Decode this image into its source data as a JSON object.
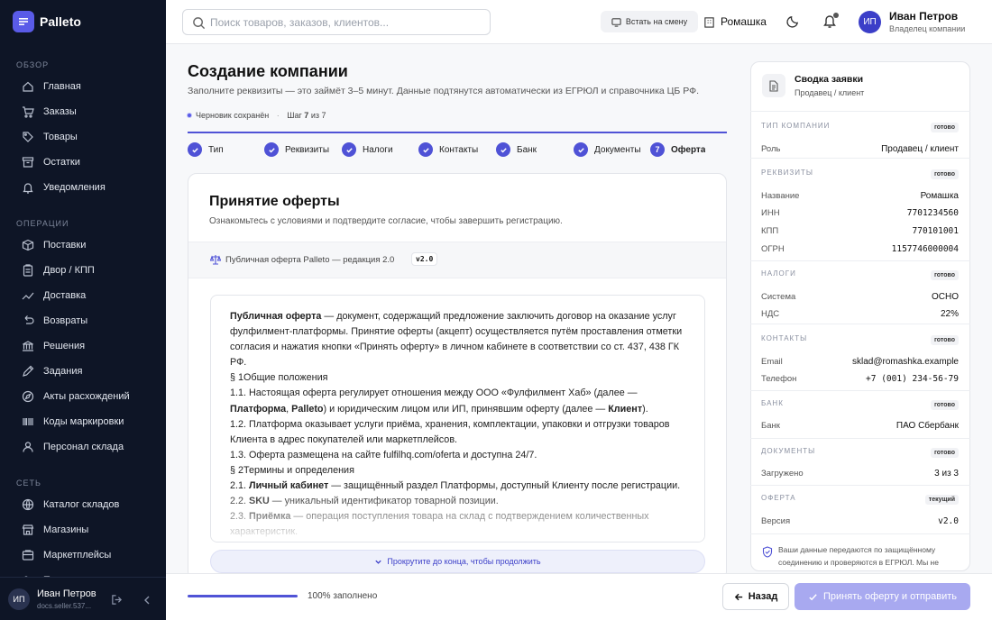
{
  "sidebar": {
    "brand": "Palleto",
    "sections": {
      "overview": "ОБЗОР",
      "operations": "ОПЕРАЦИИ",
      "network": "СЕТЬ"
    },
    "items": [
      {
        "label": "Главная",
        "icon": "home-icon"
      },
      {
        "label": "Заказы",
        "icon": "cart-icon"
      },
      {
        "label": "Товары",
        "icon": "tag-icon"
      },
      {
        "label": "Остатки",
        "icon": "archive-icon"
      },
      {
        "label": "Уведомления",
        "icon": "bell-icon"
      },
      {
        "label": "Поставки",
        "icon": "box-icon"
      },
      {
        "label": "Двор / КПП",
        "icon": "clipboard-icon"
      },
      {
        "label": "Доставка",
        "icon": "trend-icon"
      },
      {
        "label": "Возвраты",
        "icon": "return-icon"
      },
      {
        "label": "Решения",
        "icon": "bank-icon"
      },
      {
        "label": "Задания",
        "icon": "pencil-icon"
      },
      {
        "label": "Акты расхождений",
        "icon": "compass-icon"
      },
      {
        "label": "Коды маркировки",
        "icon": "barcode-icon"
      },
      {
        "label": "Персонал склада",
        "icon": "person-icon"
      },
      {
        "label": "Каталог складов",
        "icon": "globe-icon"
      },
      {
        "label": "Магазины",
        "icon": "store-icon"
      },
      {
        "label": "Маркетплейсы",
        "icon": "market-icon"
      },
      {
        "label": "Подписчики",
        "icon": "users-icon"
      }
    ],
    "user": {
      "initials": "ИП",
      "name": "Иван Петров",
      "email": "docs.seller.537..."
    }
  },
  "header": {
    "search_placeholder": "Поиск товаров, заказов, клиентов...",
    "shift_button": "Встать на смену",
    "company": "Ромашка",
    "user": {
      "initials": "ИП",
      "name": "Иван Петров",
      "role": "Владелец компании"
    }
  },
  "page": {
    "title": "Создание компании",
    "subtitle": "Заполните реквизиты — это займёт 3–5 минут. Данные подтянутся автоматически из ЕГРЮЛ и справочника ЦБ РФ.",
    "draft": "Черновик сохранён",
    "step_prefix": "Шаг",
    "step_current": "7",
    "step_of": "из",
    "step_total": "7",
    "steps": [
      "Тип",
      "Реквизиты",
      "Налоги",
      "Контакты",
      "Банк",
      "Документы",
      "Оферта"
    ],
    "current_step_number": "7"
  },
  "offer": {
    "title": "Принятие оферты",
    "subtitle": "Ознакомьтесь с условиями и подтвердите согласие, чтобы завершить регистрацию.",
    "doc_label": "Публичная оферта Palleto — редакция 2.0",
    "version": "v2.0",
    "paragraphs": [
      [
        {
          "b": "Публичная оферта"
        },
        {
          "t": " — документ, содержащий предложение заключить договор на оказание услуг фулфилмент-платформы. Принятие оферты (акцепт) осуществляется путём проставления отметки согласия и нажатия кнопки «Принять оферту» в личном кабинете в соответствии со ст. 437, 438 ГК РФ."
        }
      ],
      [
        {
          "t": "§ 1Общие положения"
        }
      ],
      [
        {
          "t": "1.1. Настоящая оферта регулирует отношения между ООО «Фулфилмент Хаб» (далее — "
        },
        {
          "b": "Платформа"
        },
        {
          "t": ", "
        },
        {
          "b": "Palleto"
        },
        {
          "t": ") и юридическим лицом или ИП, принявшим оферту (далее — "
        },
        {
          "b": "Клиент"
        },
        {
          "t": ")."
        }
      ],
      [
        {
          "t": "1.2. Платформа оказывает услуги приёма, хранения, комплектации, упаковки и отгрузки товаров Клиента в адрес покупателей или маркетплейсов."
        }
      ],
      [
        {
          "t": "1.3. Оферта размещена на сайте fulfilhq.com/oferta и доступна 24/7."
        }
      ],
      [
        {
          "t": "§ 2Термины и определения"
        }
      ],
      [
        {
          "t": "2.1. "
        },
        {
          "b": "Личный кабинет"
        },
        {
          "t": " — защищённый раздел Платформы, доступный Клиенту после регистрации."
        }
      ],
      [
        {
          "t": "2.2. "
        },
        {
          "b": "SKU"
        },
        {
          "t": " — уникальный идентификатор товарной позиции."
        }
      ],
      [
        {
          "t": "2.3. "
        },
        {
          "b": "Приёмка"
        },
        {
          "t": " — операция поступления товара на склад с подтверждением количественных характеристик."
        }
      ]
    ],
    "scroll_hint": "Прокрутите до конца, чтобы продолжить"
  },
  "footer": {
    "progress_percent": 100,
    "progress_text": "100% заполнено",
    "back": "Назад",
    "submit": "Принять оферту и отправить"
  },
  "summary": {
    "title": "Сводка заявки",
    "subtitle": "Продавец / клиент",
    "sections": [
      {
        "name": "ТИП КОМПАНИИ",
        "badge": "готово",
        "rows": [
          {
            "k": "Роль",
            "v": "Продавец / клиент",
            "mono": false
          }
        ]
      },
      {
        "name": "РЕКВИЗИТЫ",
        "badge": "готово",
        "rows": [
          {
            "k": "Название",
            "v": "Ромашка",
            "mono": false
          },
          {
            "k": "ИНН",
            "v": "7701234560",
            "mono": true
          },
          {
            "k": "КПП",
            "v": "770101001",
            "mono": true
          },
          {
            "k": "ОГРН",
            "v": "1157746000004",
            "mono": true
          }
        ]
      },
      {
        "name": "НАЛОГИ",
        "badge": "готово",
        "rows": [
          {
            "k": "Система",
            "v": "ОСНО",
            "mono": false
          },
          {
            "k": "НДС",
            "v": "22%",
            "mono": false
          }
        ]
      },
      {
        "name": "КОНТАКТЫ",
        "badge": "готово",
        "rows": [
          {
            "k": "Email",
            "v": "sklad@romashka.example",
            "mono": false
          },
          {
            "k": "Телефон",
            "v": "+7 (001) 234-56-79",
            "mono": true
          }
        ]
      },
      {
        "name": "БАНК",
        "badge": "готово",
        "rows": [
          {
            "k": "Банк",
            "v": "ПАО Сбербанк",
            "mono": false
          }
        ]
      },
      {
        "name": "ДОКУМЕНТЫ",
        "badge": "готово",
        "rows": [
          {
            "k": "Загружено",
            "v": "3 из 3",
            "mono": false
          }
        ]
      },
      {
        "name": "ОФЕРТА",
        "badge": "текущий",
        "rows": [
          {
            "k": "Версия",
            "v": "v2.0",
            "mono": true
          }
        ]
      }
    ],
    "secure_text": "Ваши данные передаются по защищённому соединению и проверяются в ЕГРЮЛ. Мы не"
  },
  "colors": {
    "accent": "#4f52d6",
    "sidebar_bg": "#0e1526",
    "submit_disabled": "#a8a9f0"
  }
}
